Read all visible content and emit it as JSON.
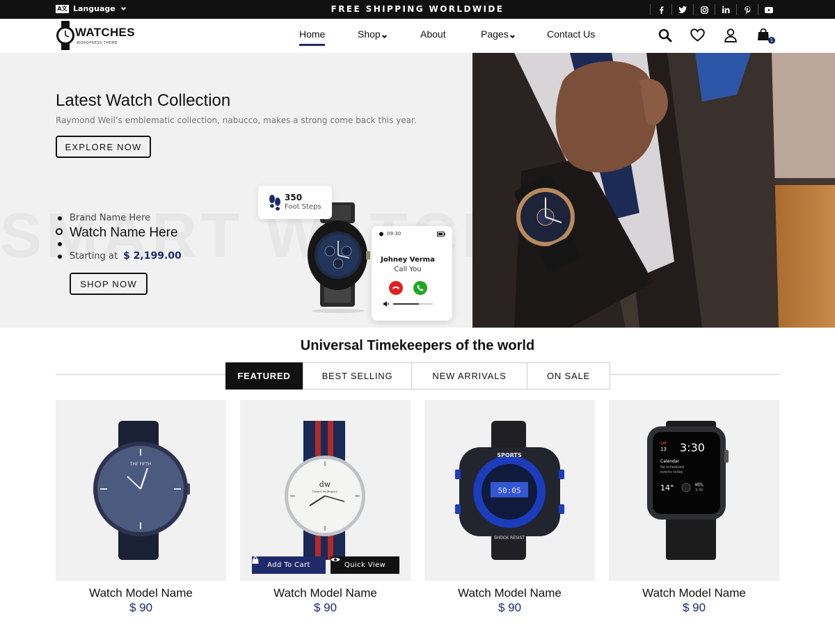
{
  "topbar": {
    "language_label": "Language",
    "language_icon_text": "A文",
    "shipping_text": "FREE SHIPPING WORLDWIDE",
    "socials": [
      "facebook-icon",
      "twitter-icon",
      "instagram-icon",
      "linkedin-icon",
      "pinterest-icon",
      "youtube-icon"
    ]
  },
  "header": {
    "logo_text": "WATCHES",
    "logo_sub": "WORDPRESS THEME",
    "nav": [
      {
        "label": "Home",
        "active": true
      },
      {
        "label": "Shop",
        "dropdown": true
      },
      {
        "label": "About"
      },
      {
        "label": "Pages",
        "dropdown": true
      },
      {
        "label": "Contact Us"
      }
    ],
    "icons": [
      "search-icon",
      "heart-icon",
      "user-icon",
      "bag-icon"
    ],
    "cart_count": "1"
  },
  "hero": {
    "title": "Latest Watch Collection",
    "subtitle": "Raymond Weil’s emblematic collection, nabucco, makes a strong come back this year.",
    "explore_label": "EXPLORE NOW",
    "background_text": "SMART WATCH",
    "brand": "Brand Name Here",
    "watch_name": "Watch Name Here",
    "starting_label": "Starting at",
    "price": "$ 2,199.00",
    "shop_label": "SHOP NOW",
    "steps_count": "350",
    "steps_label": "Foot Steps",
    "phone_time": "09:30",
    "caller_name": "Johney Verma",
    "caller_sub": "Call You"
  },
  "section": {
    "title": "Universal Timekeepers of the world",
    "tabs": [
      "FEATURED",
      "BEST SELLING",
      "NEW ARRIVALS",
      "ON SALE"
    ],
    "active_tab": "FEATURED"
  },
  "products": [
    {
      "name": "Watch Model Name",
      "price": "$ 90"
    },
    {
      "name": "Watch Model Name",
      "price": "$ 90",
      "add_to_cart": "Add To Cart",
      "quick_view": "Quick View"
    },
    {
      "name": "Watch Model Name",
      "price": "$ 90"
    },
    {
      "name": "Watch Model Name",
      "price": "$ 90"
    }
  ],
  "product_art": {
    "watch1_brand": "THE FIFTH",
    "watch2_brand": "dw",
    "watch2_sub": "Daniel Wellington",
    "watch3_brand": "SPORTS",
    "watch3_sub": "SHOCK RESIST",
    "watch3_display": "50:05",
    "watch4_day": "SAT",
    "watch4_date": "13",
    "watch4_time": "3:30",
    "watch4_cal": "Calendar",
    "watch4_cal_sub1": "No scheduled",
    "watch4_cal_sub2": "events today",
    "watch4_temp": "14°",
    "watch4_city": "MTL",
    "watch4_city_time": "3:30"
  },
  "colors": {
    "accent": "#1f2a6b",
    "topbar_bg": "#111111",
    "hero_bg": "#f1f1f1",
    "card_bg": "#f1f1f1",
    "decline": "#e02020",
    "accept": "#21a821"
  }
}
